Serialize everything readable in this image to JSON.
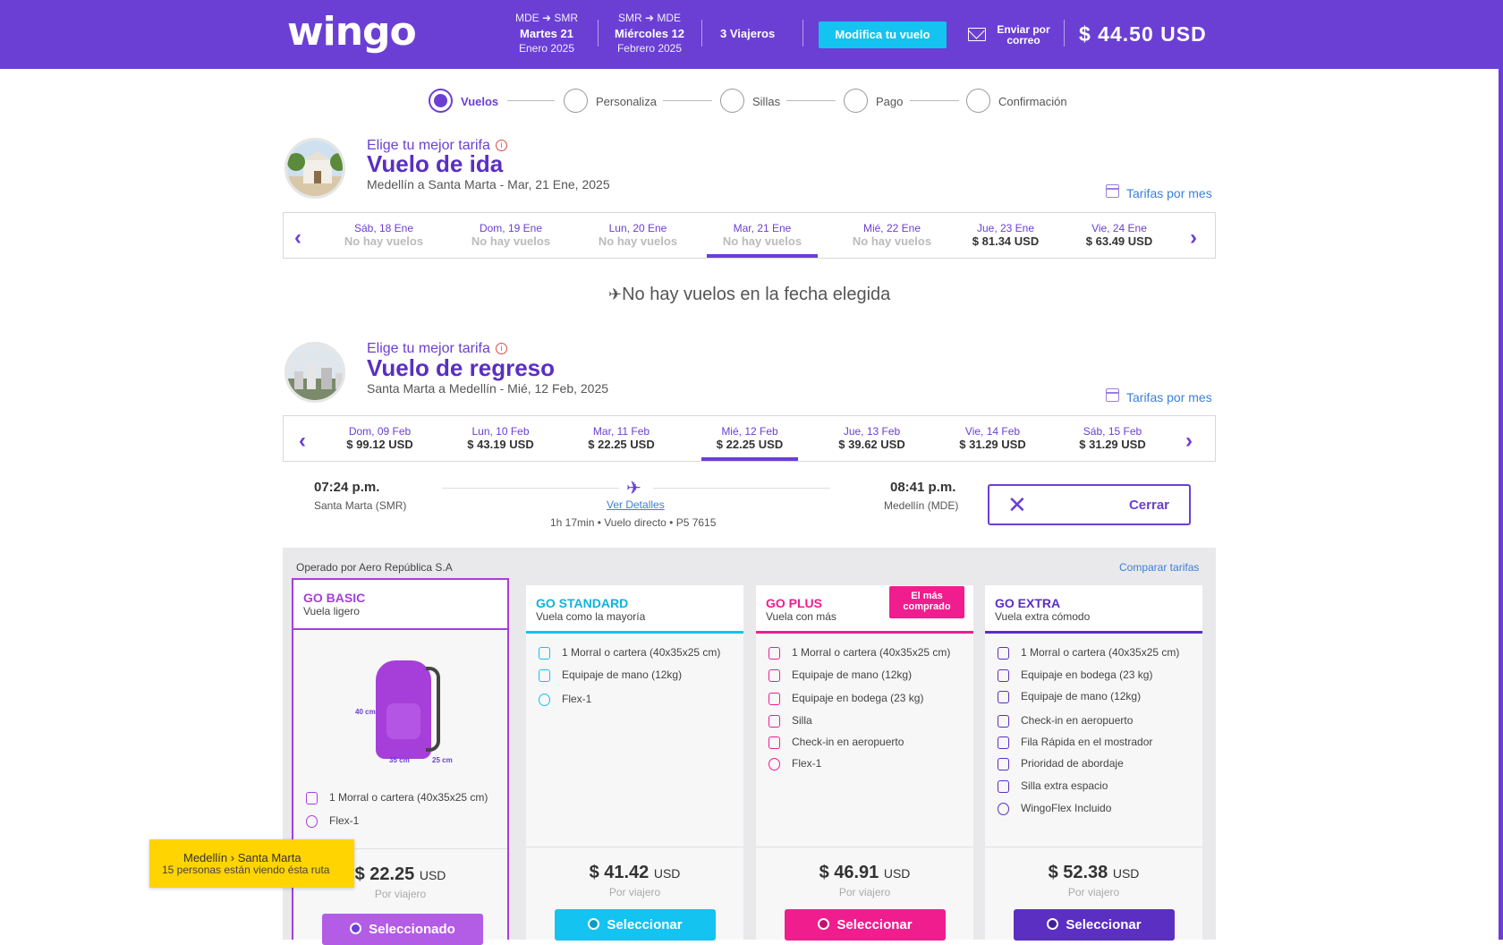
{
  "header": {
    "logo": "wingo",
    "outbound": {
      "route": "MDE ➜ SMR",
      "day": "Martes 21",
      "month": "Enero 2025"
    },
    "return": {
      "route": "SMR ➜ MDE",
      "day": "Miércoles 12",
      "month": "Febrero 2025"
    },
    "passengers": "3 Viajeros",
    "modify_label": "Modifica tu vuelo",
    "email_label": "Enviar por correo",
    "total": "$ 44.50 USD",
    "brand_color": "#6b3fd4"
  },
  "stepper": [
    {
      "label": "Vuelos",
      "active": true
    },
    {
      "label": "Personaliza",
      "active": false
    },
    {
      "label": "Sillas",
      "active": false
    },
    {
      "label": "Pago",
      "active": false
    },
    {
      "label": "Confirmación",
      "active": false
    }
  ],
  "outbound": {
    "kicker": "Elige tu mejor tarifa",
    "title": "Vuelo de ida",
    "subtitle": "Medellín a Santa Marta - Mar, 21 Ene, 2025",
    "month_link": "Tarifas por mes",
    "dates": [
      {
        "date": "Sáb, 18 Ene",
        "price": "No hay vuelos",
        "available": false
      },
      {
        "date": "Dom, 19 Ene",
        "price": "No hay vuelos",
        "available": false
      },
      {
        "date": "Lun, 20 Ene",
        "price": "No hay vuelos",
        "available": false
      },
      {
        "date": "Mar, 21 Ene",
        "price": "No hay vuelos",
        "available": false,
        "selected": true
      },
      {
        "date": "Mié, 22 Ene",
        "price": "No hay vuelos",
        "available": false
      },
      {
        "date": "Jue, 23 Ene",
        "price": "$ 81.34 USD",
        "available": true
      },
      {
        "date": "Vie, 24 Ene",
        "price": "$ 63.49 USD",
        "available": true
      }
    ],
    "no_flights": "No hay vuelos en la fecha elegida"
  },
  "return": {
    "kicker": "Elige tu mejor tarifa",
    "title": "Vuelo de regreso",
    "subtitle": "Santa Marta a Medellín - Mié, 12 Feb, 2025",
    "month_link": "Tarifas por mes",
    "dates": [
      {
        "date": "Dom, 09 Feb",
        "price": "$ 99.12 USD"
      },
      {
        "date": "Lun, 10 Feb",
        "price": "$ 43.19 USD"
      },
      {
        "date": "Mar, 11 Feb",
        "price": "$ 22.25 USD"
      },
      {
        "date": "Mié, 12 Feb",
        "price": "$ 22.25 USD",
        "selected": true
      },
      {
        "date": "Jue, 13 Feb",
        "price": "$ 39.62 USD"
      },
      {
        "date": "Vie, 14 Feb",
        "price": "$ 31.29 USD"
      },
      {
        "date": "Sáb, 15 Feb",
        "price": "$ 31.29 USD"
      }
    ]
  },
  "flight": {
    "depart_time": "07:24 p.m.",
    "depart_place": "Santa Marta (SMR)",
    "arrive_time": "08:41 p.m.",
    "arrive_place": "Medellín (MDE)",
    "details_link": "Ver Detalles",
    "meta": "1h 17min • Vuelo directo • P5 7615",
    "close_label": "Cerrar"
  },
  "fares": {
    "operated_by": "Operado por Aero República S.A",
    "compare_link": "Comparar tarifas",
    "badge": "El más comprado",
    "per_traveler": "Por viajero",
    "cards": [
      {
        "name": "GO BASIC",
        "tagline": "Vuela ligero",
        "color": "#a63fd9",
        "bag_dims": {
          "h": "40 cm",
          "w": "35 cm",
          "d": "25 cm"
        },
        "features": [
          "1 Morral o cartera (40x35x25 cm)",
          "Flex-1"
        ],
        "price": "$ 22.25",
        "currency": "USD",
        "button": "Seleccionado"
      },
      {
        "name": "GO STANDARD",
        "tagline": "Vuela como la mayoría",
        "color": "#14c3f0",
        "features": [
          "1 Morral o cartera (40x35x25 cm)",
          "Equipaje de mano (12kg)",
          "Flex-1"
        ],
        "price": "$ 41.42",
        "currency": "USD",
        "button": "Seleccionar"
      },
      {
        "name": "GO PLUS",
        "tagline": "Vuela con más",
        "color": "#f01d8e",
        "features": [
          "1 Morral o cartera (40x35x25 cm)",
          "Equipaje de mano (12kg)",
          "Equipaje en bodega (23 kg)",
          "Silla",
          "Check-in en aeropuerto",
          "Flex-1"
        ],
        "price": "$ 46.91",
        "currency": "USD",
        "button": "Seleccionar"
      },
      {
        "name": "GO EXTRA",
        "tagline": "Vuela extra cómodo",
        "color": "#5a2fc2",
        "features": [
          "1 Morral o cartera (40x35x25 cm)",
          "Equipaje en bodega (23 kg)",
          "Equipaje de mano (12kg)",
          "Check-in en aeropuerto",
          "Fila Rápida en el mostrador",
          "Prioridad de abordaje",
          "Silla extra espacio",
          "WingoFlex Incluido"
        ],
        "price": "$ 52.38",
        "currency": "USD",
        "button": "Seleccionar"
      }
    ]
  },
  "toast": {
    "origin": "Medellín",
    "separator": "›",
    "destination": "Santa Marta",
    "viewers": "15 personas están viendo ésta ruta"
  }
}
